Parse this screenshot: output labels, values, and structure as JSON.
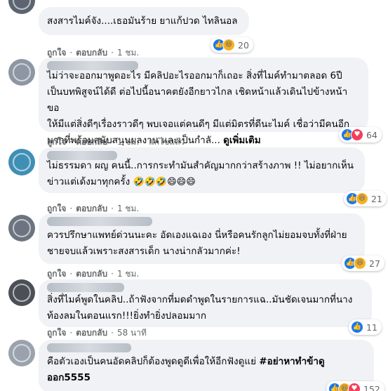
{
  "comments": [
    {
      "text": "สงสารไมค์จัง....เธอมันร้าย ยาแก้ปวด ไทลินอล",
      "actions": {
        "like": "ถูกใจ",
        "reply": "ตอบกลับ",
        "time": "1 ชม."
      },
      "reaction_count": "20",
      "reaction_icons": [
        "like-icon",
        "haha-icon"
      ]
    },
    {
      "text": "ไม่ว่าจะออกมาพูดอะไร มีคลิปอะไรออกมาก็เถอะ สิ่งที่ไมค์ทำมาตลอด 6ปี\nเป็นบทพิสูจน์ได้ดี ต่อไปนี้อนาคตยังอีกยาวไกล เชิดหน้าแล้วเดินไปข้างหน้า ขอ\nให้มีแต่สิ่งดีๆเรื่องราวดีๆ พบเจอแต่คนดีๆ มีแต่มิตรที่ดีนะไมค์ เชื่อว่ามีคนอีก\nมากที่พร้อมสนับสนุนผลงาน และเป็นกำลั...",
      "see_more": "ดูเพิ่มเติม",
      "actions": {
        "like": "ถูกใจ",
        "reply": "ตอบกลับ",
        "time": "1 ชม.",
        "edited": "แก้ไขแล้ว"
      },
      "reaction_count": "64",
      "reaction_icons": [
        "like-icon",
        "love-icon"
      ]
    },
    {
      "text": "ไม่ธรรมดา ผญ คนนี้..การกระทำมันสำคัญมากกว่าสร้างภาพ !! ไม่อยากเห็น\nข่าวแต่เด้งมาทุกครั้ง",
      "emojis": "🤣🤣🤣😄😄😄",
      "actions": {
        "like": "ถูกใจ",
        "reply": "ตอบกลับ",
        "time": "1 ชม."
      },
      "reaction_count": "21",
      "reaction_icons": [
        "like-icon",
        "haha-icon"
      ]
    },
    {
      "text": "ควรปรึกษาแพทย์ด่วนนะคะ อัดเองแฉเอง นี่หรือคนรักลูกไม่ยอมจบทั้งที่ฝ่าย\nชายจบแล้วเพราะสงสารเด็ก นางน่ากลัวมากค่ะ!",
      "actions": {
        "like": "ถูกใจ",
        "reply": "ตอบกลับ",
        "time": "1 ชม."
      },
      "reaction_count": "27",
      "reaction_icons": [
        "like-icon",
        "haha-icon"
      ]
    },
    {
      "text": "สิ่งที่ไมค์พูดในคลิป..ถ้าฟังจากที่มดดำพูดในรายการแฉ..มันชัดเจนมากที่นาง\nท้องลมในตอนแรก!!!ยิ่งทำยิ่งปลอมมาก",
      "actions": {
        "like": "ถูกใจ",
        "reply": "ตอบกลับ",
        "time": "58 นาที"
      },
      "reaction_count": "11",
      "reaction_icons": [
        "like-icon"
      ]
    },
    {
      "text": "คือตัวเองเป็นคนอัดคลิปก็ต้องพูดดูดีเพื่อให้อีกฟังดูแย่ ",
      "hashtag": "#อย่าหาทำข้าดู\nออก5555",
      "reaction_count": "152",
      "reaction_icons": [
        "like-icon",
        "haha-icon",
        "love-icon"
      ]
    }
  ],
  "colors": {
    "bubble": "#f0f2f5",
    "meta": "#65676b",
    "like": "#1877f2",
    "love": "#f33e58",
    "haha": "#f7b125"
  }
}
